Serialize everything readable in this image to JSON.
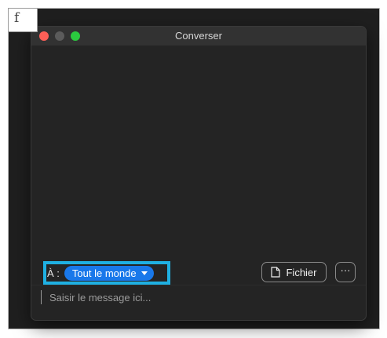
{
  "annotation": {
    "step": "f"
  },
  "window": {
    "title": "Converser"
  },
  "chat": {
    "to_label": "À :",
    "recipient": "Tout le monde",
    "file_button": "Fichier",
    "more_button": "···",
    "message_placeholder": "Saisir le message ici..."
  },
  "colors": {
    "highlight": "#1fb0e2",
    "recipient_pill": "#1978ea",
    "window_bg": "#242424"
  }
}
